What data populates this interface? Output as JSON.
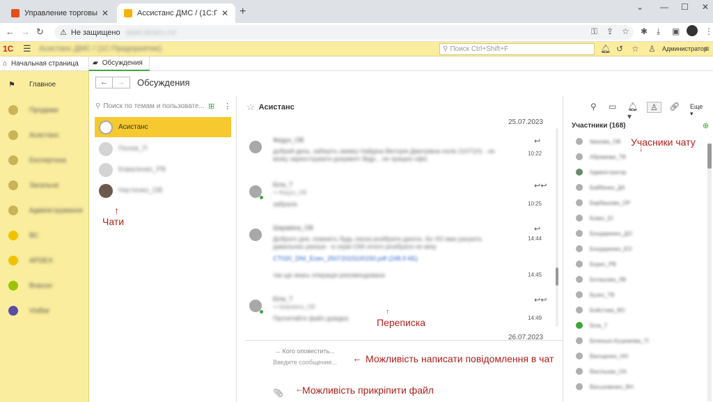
{
  "browser": {
    "tabs": [
      {
        "title": "Управление торговым предпр",
        "close": "✕"
      },
      {
        "title": "Ассистанс ДМС / (1С:Предприя",
        "close": "✕"
      }
    ],
    "new_tab": "+",
    "security_label": "Не защищено",
    "url": "asist.dmsru.ru/"
  },
  "app": {
    "logo": "1С",
    "title": "Асистанс ДМС / (1С:Предприятие)",
    "search_placeholder": "Поиск Ctrl+Shift+F",
    "user": "Администратор"
  },
  "section_tabs": [
    {
      "label": "Начальная страница"
    },
    {
      "label": "Обсуждения"
    }
  ],
  "sidebar": {
    "items": [
      {
        "label": "Главное",
        "color": "#333333",
        "icon": "flag-icon"
      },
      {
        "label": "Продажи",
        "color": "#b9a544"
      },
      {
        "label": "Асистанс",
        "color": "#b9a544"
      },
      {
        "label": "Експертиза",
        "color": "#b9a544"
      },
      {
        "label": "Загальне",
        "color": "#b9a544"
      },
      {
        "label": "Адміністрування",
        "color": "#b9a544"
      },
      {
        "label": "ВС",
        "color": "#f2c200"
      },
      {
        "label": "APDEX",
        "color": "#f2c200"
      },
      {
        "label": "Вчасно",
        "color": "#9bc400"
      },
      {
        "label": "VisBar",
        "color": "#5a4ea3"
      }
    ]
  },
  "page": {
    "title": "Обсуждения",
    "back": "←",
    "forward": "→"
  },
  "chats": {
    "search_placeholder": "Поиск по темам и пользовате...",
    "items": [
      {
        "name": "Асистанс",
        "active": true
      },
      {
        "name": "Полєв_П"
      },
      {
        "name": "Коваленко_РВ"
      },
      {
        "name": "Настенко_ОВ"
      }
    ]
  },
  "conversation": {
    "title": "Асистанс",
    "dates": [
      "25.07.2023",
      "26.07.2023"
    ],
    "messages": [
      {
        "author": "Федун_ОВ",
        "quote": "",
        "text": "добрий день, заберіть заявку Найдіна Вікторія Дмитрівна полік 2107101 . не можу зареєструвати документ Відр... не працює офіс",
        "link": "",
        "time": "10:22",
        "reply_icon": "↩",
        "online": false
      },
      {
        "author": "Біла_Т",
        "quote": "↪ Федун_ОВ",
        "text": "забрала",
        "link": "",
        "time": "10:25",
        "reply_icon": "↩↩",
        "online": true
      },
      {
        "author": "Шаравіна_ОВ",
        "quote": "",
        "text": "Доброго дня, повежіть будь ласка розібрати дангох. Бо ХО вже рахують давальних раніше - в серві СКК нічого розібрати не міну",
        "link": "CT020_DNI_Ecen_25072023100150.pdf (248.9 КБ)",
        "extra": "так ще якась операція рекомендована",
        "time": "14:44",
        "time2": "14:45",
        "reply_icon": "↩",
        "online": false
      },
      {
        "author": "Біла_Т",
        "quote": "↪ Шаравіна_ОВ",
        "text": "Прочитайте файл довідка",
        "link": "",
        "time": "14:49",
        "reply_icon": "↩↩",
        "online": true
      }
    ],
    "notify_placeholder": "Кого оповестить...",
    "input_placeholder": "Введите сообщение...",
    "more_label": "Еще"
  },
  "members": {
    "title": "Участники (168)",
    "items": [
      "Іванова_ОВ",
      "Абрамова_ТВ",
      "Адміністратор",
      "Байбенко_ДА",
      "Барбашова_ОР",
      "Бовкс_ЕІ",
      "Бондаренко_ДО",
      "Бондаренко_ЕО",
      "Борис_РВ",
      "Боташова_ЛВ",
      "Бузко_ТВ",
      "Бойстова_ВО",
      "Біла_Т",
      "Біленько-Куцюмова_ТІ",
      "Васіщенко_НН",
      "Васільєва_ОА",
      "Васьковенко_ВН"
    ]
  },
  "annotations": {
    "chats": "Чати",
    "members": "Учасники чату",
    "correspondence": "Переписка",
    "write_message": "Можливість написати повідомлення в чат",
    "attach_file": "Можливість прикріпити файл"
  },
  "colors": {
    "accent_yellow": "#f5c92f",
    "sidebar_bg": "#fbed9e",
    "annotation": "#b0201a",
    "online": "#3da73c"
  }
}
